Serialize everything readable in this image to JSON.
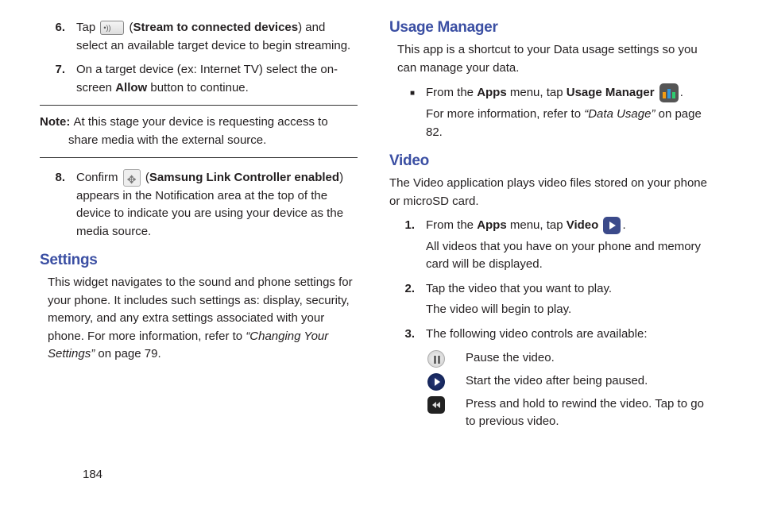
{
  "left": {
    "step6": {
      "num": "6.",
      "pre": "Tap ",
      "iconLabel": "Stream to connected devices",
      "post": ") and select an available target device to begin streaming."
    },
    "step7": {
      "num": "7.",
      "textA": "On a target device (ex: Internet TV) select the on-screen ",
      "allow": "Allow",
      "textB": " button to continue."
    },
    "note": {
      "label": "Note: ",
      "text": "At this stage your device is requesting access to share media with the external source."
    },
    "step8": {
      "num": "8.",
      "pre": " Confirm ",
      "iconLabel": "Samsung Link Controller enabled",
      "post": ") appears in the Notification area at the top of the device to indicate you are using your device as the media source."
    },
    "settings": {
      "heading": "Settings",
      "body1": "This widget navigates to the sound and phone settings for your phone. It includes such settings as: display, security, memory, and any extra settings associated with your phone. For more information, refer to ",
      "ref": "“Changing Your Settings”",
      "body2": "  on page 79."
    }
  },
  "right": {
    "usage": {
      "heading": "Usage Manager",
      "intro": "This app is a shortcut to your Data usage settings so you can manage your data.",
      "bulletPre": "From the ",
      "apps": "Apps",
      "bulletMid": " menu, tap ",
      "um": "Usage Manager",
      "bulletPost": ".",
      "more1": "For more information, refer to ",
      "ref": "“Data Usage”",
      "more2": "  on page 82."
    },
    "video": {
      "heading": "Video",
      "intro": "The Video application plays video files stored on your phone or microSD card.",
      "step1": {
        "num": "1.",
        "pre": "From the ",
        "apps": "Apps",
        "mid": " menu, tap ",
        "vid": "Video",
        "post": ".",
        "line2": "All videos that you have on your phone and memory card will be displayed."
      },
      "step2": {
        "num": "2.",
        "line1": "Tap the video that you want to play.",
        "line2": "The video will begin to play."
      },
      "step3": {
        "num": "3.",
        "text": "The following video controls are available:"
      },
      "controls": {
        "pause": "Pause the video.",
        "play": "Start the video after being paused.",
        "rewind": "Press and hold to rewind the video. Tap to go to previous video."
      }
    }
  },
  "pageNumber": "184"
}
